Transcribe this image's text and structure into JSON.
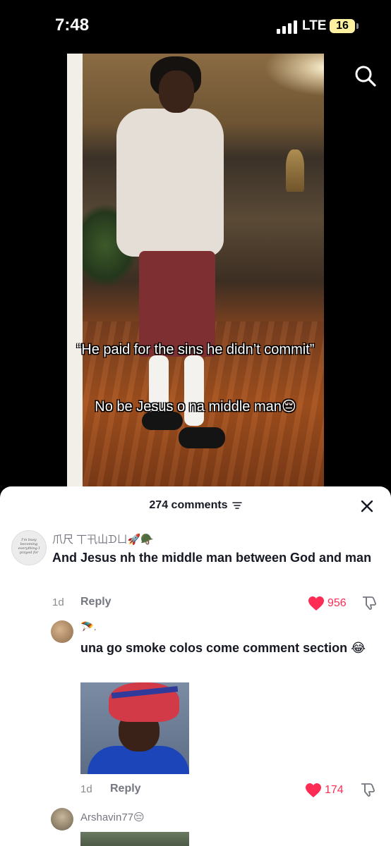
{
  "status_bar": {
    "time": "7:48",
    "network": "LTE",
    "battery": "16"
  },
  "video": {
    "caption_line1": "“He paid for the sins he didn’t commit”",
    "caption_line2": "No be Jesus o na middle man😔",
    "search_icon": "search-icon"
  },
  "comments_sheet": {
    "count_label": "274 comments",
    "sort_icon": "sort-icon",
    "close_icon": "close-icon",
    "comments": [
      {
        "username": "爪尺 丅卂山ᗪㄩ🚀🪖",
        "avatar_text": "I'm busy becoming everything I prayed for",
        "text": "And Jesus nh the middle man between God and man",
        "date": "1d",
        "reply_label": "Reply",
        "likes": "956"
      },
      {
        "username": "🪂.",
        "text": "una go smoke colos come comment section 😂",
        "date": "1d",
        "reply_label": "Reply",
        "likes": "174",
        "has_image": true
      },
      {
        "username": "Arshavin77😔"
      }
    ]
  },
  "colors": {
    "like_red": "#fe2c55",
    "text_dark": "#161823",
    "text_grey": "#757780"
  }
}
